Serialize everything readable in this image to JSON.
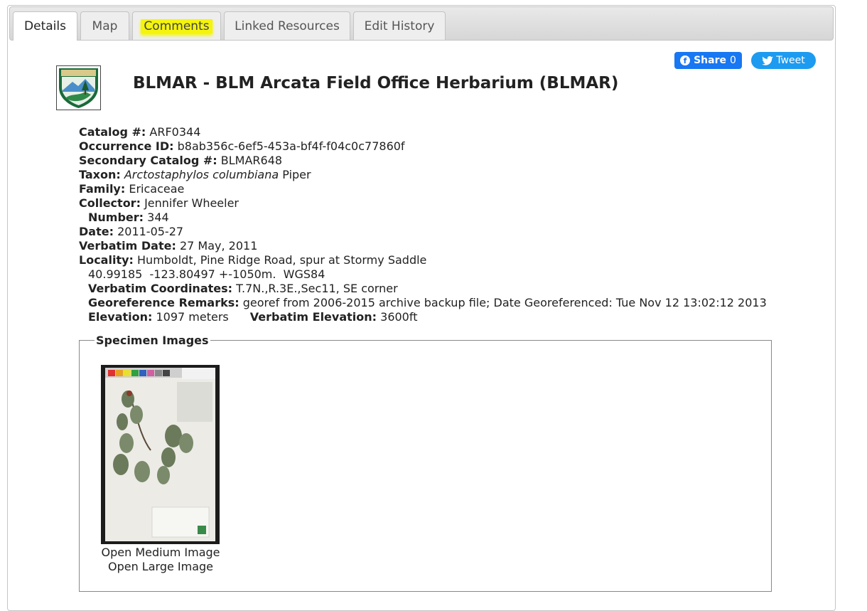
{
  "tabs": [
    {
      "label": "Details",
      "active": true
    },
    {
      "label": "Map",
      "active": false
    },
    {
      "label": "Comments",
      "active": false,
      "highlighted": true
    },
    {
      "label": "Linked Resources",
      "active": false
    },
    {
      "label": "Edit History",
      "active": false
    }
  ],
  "social": {
    "share_label": "Share",
    "share_count": "0",
    "tweet_label": "Tweet",
    "facebook_color": "#1877f2",
    "twitter_color": "#1d9bf0"
  },
  "header": {
    "title": "BLMAR - BLM Arcata Field Office Herbarium (BLMAR)",
    "logo_icon": "blm-shield-logo"
  },
  "record": {
    "catalog_label": "Catalog #:",
    "catalog": "ARF0344",
    "occurrence_label": "Occurrence ID:",
    "occurrence_id": "b8ab356c-6ef5-453a-bf4f-f04c0c77860f",
    "secondary_label": "Secondary Catalog #:",
    "secondary_catalog": "BLMAR648",
    "taxon_label": "Taxon:",
    "taxon_name": "Arctostaphylos columbiana",
    "taxon_author": "Piper",
    "family_label": "Family:",
    "family": "Ericaceae",
    "collector_label": "Collector:",
    "collector": "Jennifer Wheeler",
    "number_label": "Number:",
    "number": "344",
    "date_label": "Date:",
    "date": "2011-05-27",
    "verbatim_date_label": "Verbatim Date:",
    "verbatim_date": "27 May, 2011",
    "locality_label": "Locality:",
    "locality": "Humboldt, Pine Ridge Road, spur at Stormy Saddle",
    "coordinates": "40.99185  -123.80497 +-1050m.  WGS84",
    "verbatim_coords_label": "Verbatim Coordinates:",
    "verbatim_coords": "T.7N.,R.3E.,Sec11, SE corner",
    "georef_label": "Georeference Remarks:",
    "georef_remarks": "georef from 2006-2015 archive backup file; Date Georeferenced: Tue Nov 12 13:02:12 2013",
    "elevation_label": "Elevation:",
    "elevation": "1097 meters",
    "verbatim_elev_label": "Verbatim Elevation:",
    "verbatim_elevation": "3600ft"
  },
  "images": {
    "legend": "Specimen Images",
    "open_medium": "Open Medium Image",
    "open_large": "Open Large Image"
  },
  "colors": {
    "tab_highlight": "#f4f40e"
  }
}
